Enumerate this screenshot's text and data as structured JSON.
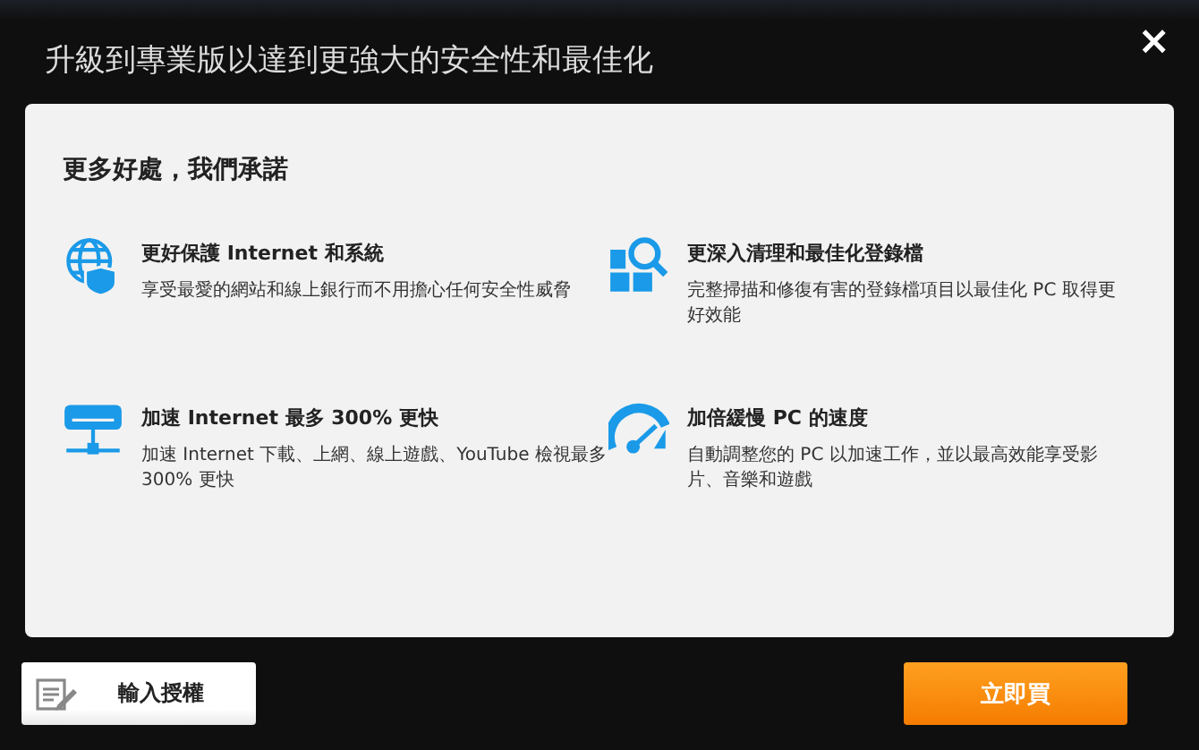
{
  "window": {
    "title": "升級到專業版以達到更強大的安全性和最佳化",
    "close": "×"
  },
  "panel": {
    "heading": "更多好處，我們承諾",
    "features": [
      {
        "kind": "globe",
        "title": "更好保護 Internet 和系統",
        "text": "享受最愛的網站和線上銀行而不用擔心任何安全性威脅"
      },
      {
        "kind": "registry",
        "title": "更深入清理和最佳化登錄檔",
        "text": "完整掃描和修復有害的登錄檔項目以最佳化 PC 取得更好效能"
      },
      {
        "kind": "network",
        "title": "加速 Internet 最多 300% 更快",
        "text": "加速 Internet 下載、上網、線上遊戲、YouTube 檢視最多 300% 更快"
      },
      {
        "kind": "gauge",
        "title": "加倍緩慢 PC 的速度",
        "text": "自動調整您的 PC 以加速工作，並以最高效能享受影片、音樂和遊戲"
      }
    ]
  },
  "buttons": {
    "license": "輸入授權",
    "buy": "立即買"
  }
}
